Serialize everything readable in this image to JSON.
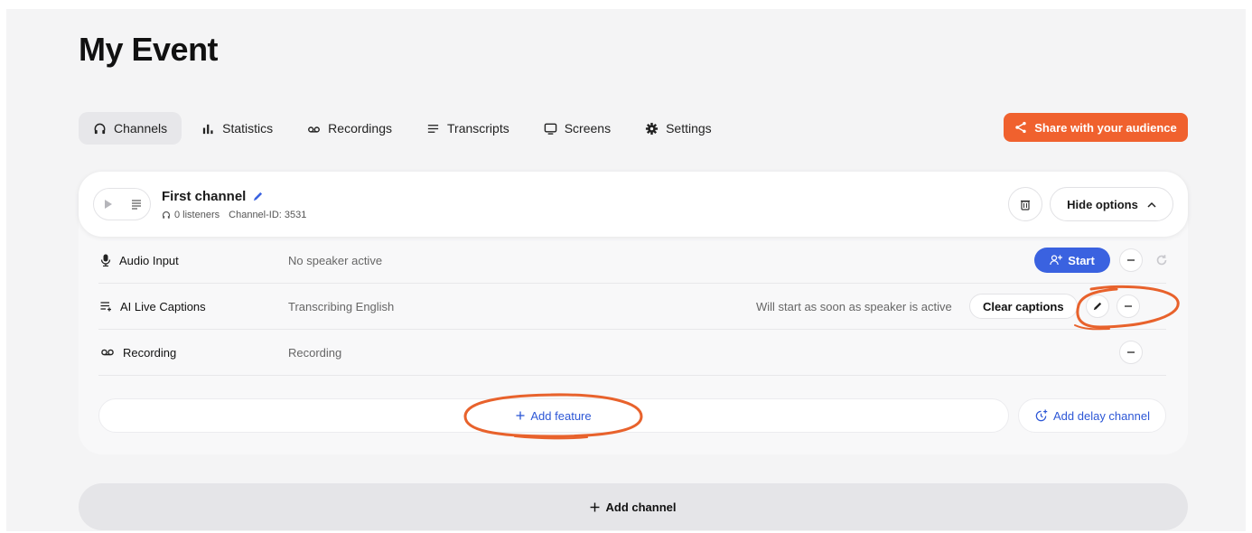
{
  "page": {
    "title": "My Event"
  },
  "tabs": [
    {
      "label": "Channels",
      "icon": "headphones-icon",
      "active": true
    },
    {
      "label": "Statistics",
      "icon": "bar-chart-icon",
      "active": false
    },
    {
      "label": "Recordings",
      "icon": "voicemail-icon",
      "active": false
    },
    {
      "label": "Transcripts",
      "icon": "lines-icon",
      "active": false
    },
    {
      "label": "Screens",
      "icon": "monitor-icon",
      "active": false
    },
    {
      "label": "Settings",
      "icon": "gear-icon",
      "active": false
    }
  ],
  "share": {
    "label": "Share with your audience",
    "icon": "share-icon",
    "color": "#f0612e"
  },
  "channel": {
    "name": "First channel",
    "listeners": "0 listeners",
    "channel_id": "Channel-ID: 3531",
    "hide_options_label": "Hide options"
  },
  "features": {
    "audio_input": {
      "label": "Audio Input",
      "status": "No speaker active",
      "start_label": "Start"
    },
    "captions": {
      "label": "AI Live Captions",
      "status": "Transcribing English",
      "note": "Will start as soon as speaker is active",
      "clear_label": "Clear captions"
    },
    "recording": {
      "label": "Recording",
      "status": "Recording"
    }
  },
  "actions": {
    "add_feature": "Add feature",
    "add_delay_channel": "Add delay channel",
    "add_channel": "Add channel"
  },
  "colors": {
    "accent_blue": "#3a62e0",
    "link_blue": "#2d57d6",
    "annotation": "#e8622c"
  }
}
